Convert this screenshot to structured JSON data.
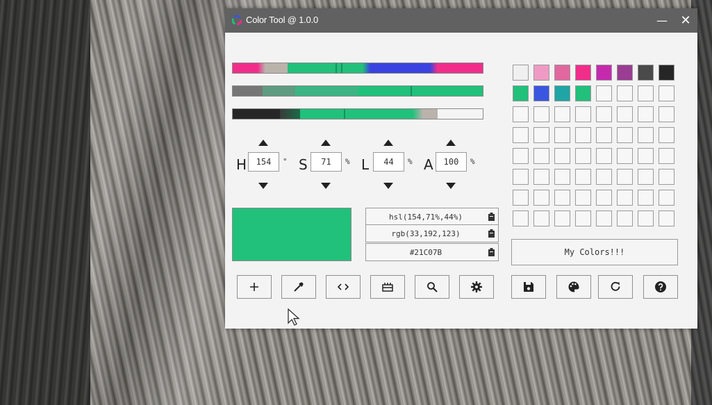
{
  "window": {
    "title": "Color Tool @ 1.0.0",
    "minimize_label": "—",
    "close_label": "✕"
  },
  "gradient_bars": {
    "hue_bar": [
      "#f02e8a",
      "#b9b3ac",
      "#21c07b",
      "#21c07b",
      "#3a43e0",
      "#3a43e0",
      "#f02e8a"
    ],
    "saturation_bar": [
      "#767676",
      "#5f9b81",
      "#3db483",
      "#21c07b"
    ],
    "lightness_bar": [
      "#262626",
      "#1a6b47",
      "#21c07b",
      "#b9b3ac",
      "#f4f4f4"
    ]
  },
  "controls": {
    "hue": {
      "letter": "H",
      "value": "154",
      "unit": "°"
    },
    "saturation": {
      "letter": "S",
      "value": "71",
      "unit": "%"
    },
    "lightness": {
      "letter": "L",
      "value": "44",
      "unit": "%"
    },
    "alpha": {
      "letter": "A",
      "value": "100",
      "unit": "%"
    }
  },
  "preview": {
    "color": "#21c07b"
  },
  "formats": {
    "hsl": "hsl(154,71%,44%)",
    "rgb": "rgb(33,192,123)",
    "hex": "#21C07B"
  },
  "swatches": {
    "row1": [
      "#f0f0f0",
      "#ef9ac4",
      "#e2679e",
      "#f02e8a",
      "#c52aae",
      "#9a3d93",
      "#4a4a4a",
      "#262626"
    ],
    "row2": [
      "#21c07b",
      "#3a55e0",
      "#1fa5a5",
      "#21c07b"
    ],
    "empty_rows": 6
  },
  "my_colors_label": "My Colors!!!",
  "toolbar": {
    "left": [
      "add-icon",
      "eyedropper-icon",
      "code-icon",
      "palette-strip-icon",
      "zoom-icon",
      "gear-icon"
    ],
    "right": [
      "save-icon",
      "palette-icon",
      "refresh-icon",
      "help-icon"
    ]
  }
}
